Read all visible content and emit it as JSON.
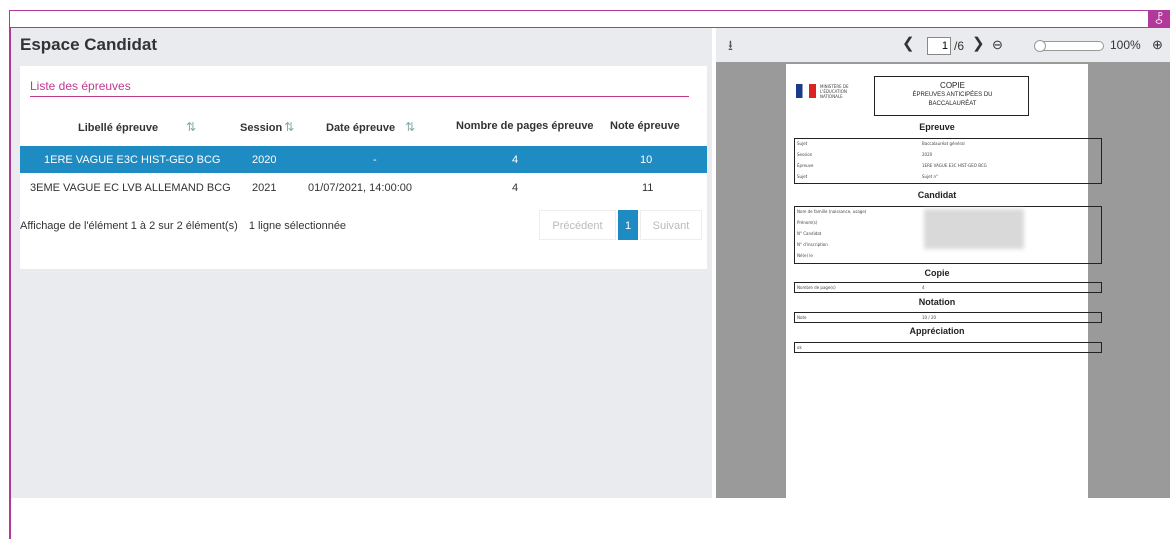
{
  "app": {
    "title": "Espace Candidat"
  },
  "epreuves": {
    "list_title": "Liste des épreuves",
    "columns": [
      "Libellé épreuve",
      "Session",
      "Date épreuve",
      "Nombre de pages épreuve",
      "Note épreuve"
    ],
    "rows": [
      {
        "libelle": "1ERE VAGUE E3C HIST-GEO BCG",
        "session": "2020",
        "date": "-",
        "pages": "4",
        "note": "10",
        "selected": true
      },
      {
        "libelle": "3EME VAGUE EC LVB ALLEMAND BCG",
        "session": "2021",
        "date": "01/07/2021, 14:00:00",
        "pages": "4",
        "note": "11",
        "selected": false
      }
    ],
    "info": "Affichage de l'élément 1 à 2 sur 2 élément(s)",
    "selection_info": "1 ligne sélectionnée",
    "pagination": {
      "previous": "Précédent",
      "current": "1",
      "next": "Suivant"
    }
  },
  "viewer": {
    "page_current": "1",
    "page_total": "/6",
    "zoom": "100%",
    "icons": {
      "download": "download-icon",
      "prev": "chevron-left-icon",
      "next": "chevron-right-icon",
      "zoom_out": "zoom-out-icon",
      "zoom_in": "zoom-in-icon"
    }
  },
  "document": {
    "header_title": "COPIE",
    "header_sub1": "ÉPREUVES ANTICIPÉES DU",
    "header_sub2": "BACCALAURÉAT",
    "ministry": "MINISTÈRE DE L'ÉDUCATION NATIONALE",
    "section_epreuve": "Epreuve",
    "section_candidat": "Candidat",
    "section_copie": "Copie",
    "section_notation": "Notation",
    "section_appreciation": "Appréciation",
    "epreuve_rows": [
      {
        "label": "Sujet",
        "value": "Baccalauréat général"
      },
      {
        "label": "Session",
        "value": "2020"
      },
      {
        "label": "Épreuve",
        "value": "1ERE VAGUE E3C HIST-GEO BCG"
      },
      {
        "label": "Sujet",
        "value": "Sujet n°"
      }
    ],
    "candidat_rows": [
      {
        "label": "Nom de famille (naissance, usage)"
      },
      {
        "label": "Prénom(s)"
      },
      {
        "label": "N° Candidat"
      },
      {
        "label": "N° d'inscription"
      },
      {
        "label": "Né(e) le"
      }
    ],
    "copie_label": "Nombre de page(s)",
    "copie_value": "4",
    "note_label": "Note",
    "note_value": "10 / 20",
    "appreciation_value": "ok"
  },
  "colors": {
    "accent": "#b0399a",
    "selected_row": "#1e8bc3",
    "panel": "#e9ebee"
  }
}
